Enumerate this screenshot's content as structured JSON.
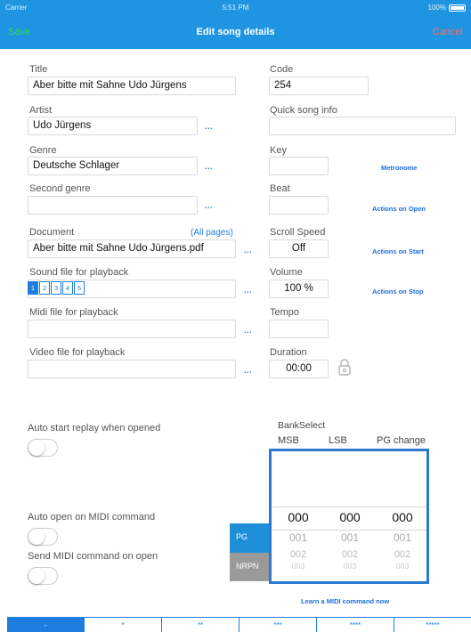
{
  "status_bar": {
    "carrier": "Carrier",
    "time": "5:51 PM",
    "battery": "100%"
  },
  "nav": {
    "save": "Save",
    "title": "Edit song details",
    "cancel": "Cancel"
  },
  "colors": {
    "accent": "#1f94e0",
    "save": "#2fe04a",
    "cancel": "#ff6b5b",
    "picker_border": "#2c79d1"
  },
  "left": {
    "title_label": "Title",
    "title_value": "Aber bitte mit Sahne Udo Jürgens",
    "artist_label": "Artist",
    "artist_value": "Udo Jürgens",
    "genre_label": "Genre",
    "genre_value": "Deutsche Schlager",
    "second_genre_label": "Second genre",
    "second_genre_value": "",
    "document_label": "Document",
    "all_pages": "(All pages)",
    "document_value": "Aber bitte mit Sahne Udo Jürgens.pdf",
    "sound_label": "Sound file for playback",
    "sound_tabs": [
      "1",
      "2",
      "3",
      "4",
      "5"
    ],
    "sound_active_index": 0,
    "midi_label": "Midi file for playback",
    "video_label": "Video file for playback",
    "dots": "..."
  },
  "right": {
    "code_label": "Code",
    "code_value": "254",
    "quick_info_label": "Quick song info",
    "key_label": "Key",
    "metronome": "Metronome",
    "beat_label": "Beat",
    "actions_open": "Actions on Open",
    "scroll_label": "Scroll Speed",
    "scroll_value": "Off",
    "actions_start": "Actions on Start",
    "volume_label": "Volume",
    "volume_value": "100 %",
    "actions_stop": "Actions on Stop",
    "tempo_label": "Tempo",
    "duration_label": "Duration",
    "duration_value": "00:00"
  },
  "toggles": {
    "auto_start": "Auto start replay when opened",
    "auto_open_midi": "Auto open on MIDI command",
    "send_midi": "Send MIDI command on open"
  },
  "midi": {
    "bank_select": "BankSelect",
    "msb": "MSB",
    "lsb": "LSB",
    "pg_change": "PG change",
    "selected": [
      "000",
      "000",
      "000"
    ],
    "next1": [
      "001",
      "001",
      "001"
    ],
    "next2": [
      "002",
      "002",
      "002"
    ],
    "next3": [
      "003",
      "003",
      "003"
    ],
    "pg": "PG",
    "nrpn": "NRPN",
    "learn": "Learn a MIDI command now"
  },
  "rating": {
    "tabs": [
      "-",
      "*",
      "**",
      "***",
      "****",
      "*****"
    ],
    "active_index": 0
  }
}
